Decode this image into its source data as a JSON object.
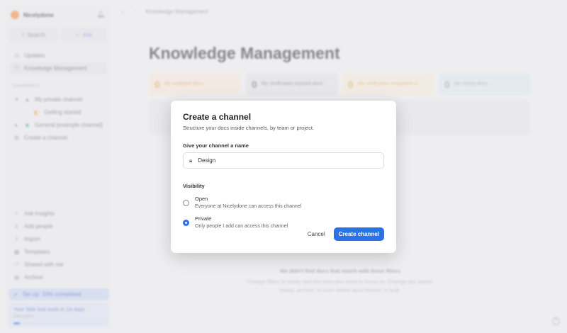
{
  "sidebar": {
    "brand": "Nicelydone",
    "search": "Search",
    "ask": "Ask",
    "updates": "Updates",
    "knowledge": "Knowledge Management",
    "channels_header": "CHANNELS",
    "private_channel": "My private channel",
    "getting_started": "Getting started",
    "general": "General [example channel]",
    "create_channel": "Create a channel",
    "ask_insights": "Ask Insights",
    "add_people": "Add people",
    "import": "Import",
    "templates": "Templates",
    "shared": "Shared with me",
    "archive": "Archive",
    "setup": "Set up: 33% completed",
    "trial": "Your Slite trial ends in 14 days",
    "see_plans": "See plans",
    "trial_progress": 0.07
  },
  "header": {
    "breadcrumb": "Knowledge Management"
  },
  "main": {
    "title": "Knowledge Management",
    "cards": [
      {
        "count": "0",
        "label": "My outdated docs"
      },
      {
        "count": "0",
        "label": "My verification expired docs"
      },
      {
        "count": "0",
        "label": "My verification requested d..."
      },
      {
        "count": "0",
        "label": "My empty docs"
      }
    ],
    "empty_title": "We didn't find docs that match with these filters",
    "empty_text": "Change filters to easily spot the ones you need to focus on. Change doc owner, status, archive, or even delete docs forever, in bulk."
  },
  "modal": {
    "title": "Create a channel",
    "subtitle": "Structure your docs inside channels, by team or project.",
    "name_label": "Give your channel a name",
    "name_value": "Design",
    "visibility_label": "Visibility",
    "options": [
      {
        "title": "Open",
        "desc": "Everyone at Nicelydone can access this channel",
        "selected": false
      },
      {
        "title": "Private",
        "desc": "Only people I add can access this channel",
        "selected": true
      }
    ],
    "cancel": "Cancel",
    "create": "Create channel"
  },
  "colors": {
    "accent": "#2b72e6"
  }
}
